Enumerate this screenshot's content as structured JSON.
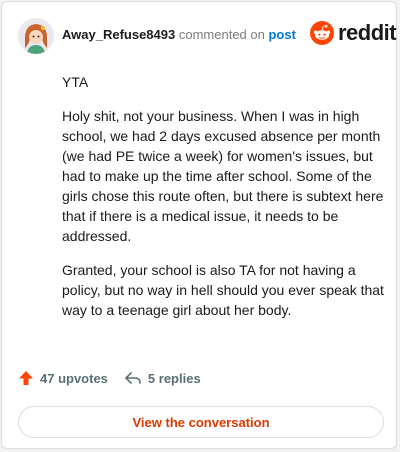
{
  "header": {
    "username": "Away_Refuse8493",
    "action_text": "commented on",
    "post_link": "post",
    "logo_word": "reddit"
  },
  "comment": {
    "paragraphs": [
      "YTA",
      "Holy shit, not your business. When I was in high school, we had 2 days excused absence per month (we had PE twice a week) for women's issues, but had to make up the time after school. Some of the girls chose this route often, but there is subtext here that if there is a medical issue, it needs to be addressed.",
      "Granted, your school is also TA for not having a policy, but no way in hell should you ever speak that way to a teenage girl about her body."
    ]
  },
  "footer": {
    "upvotes": "47 upvotes",
    "replies": "5 replies",
    "upvote_icon": "upvote-arrow-icon",
    "reply_icon": "reply-arrow-icon"
  },
  "button": {
    "label": "View the conversation"
  },
  "colors": {
    "accent": "#d93a00",
    "link": "#0079d3",
    "upvote": "#ff4500"
  }
}
